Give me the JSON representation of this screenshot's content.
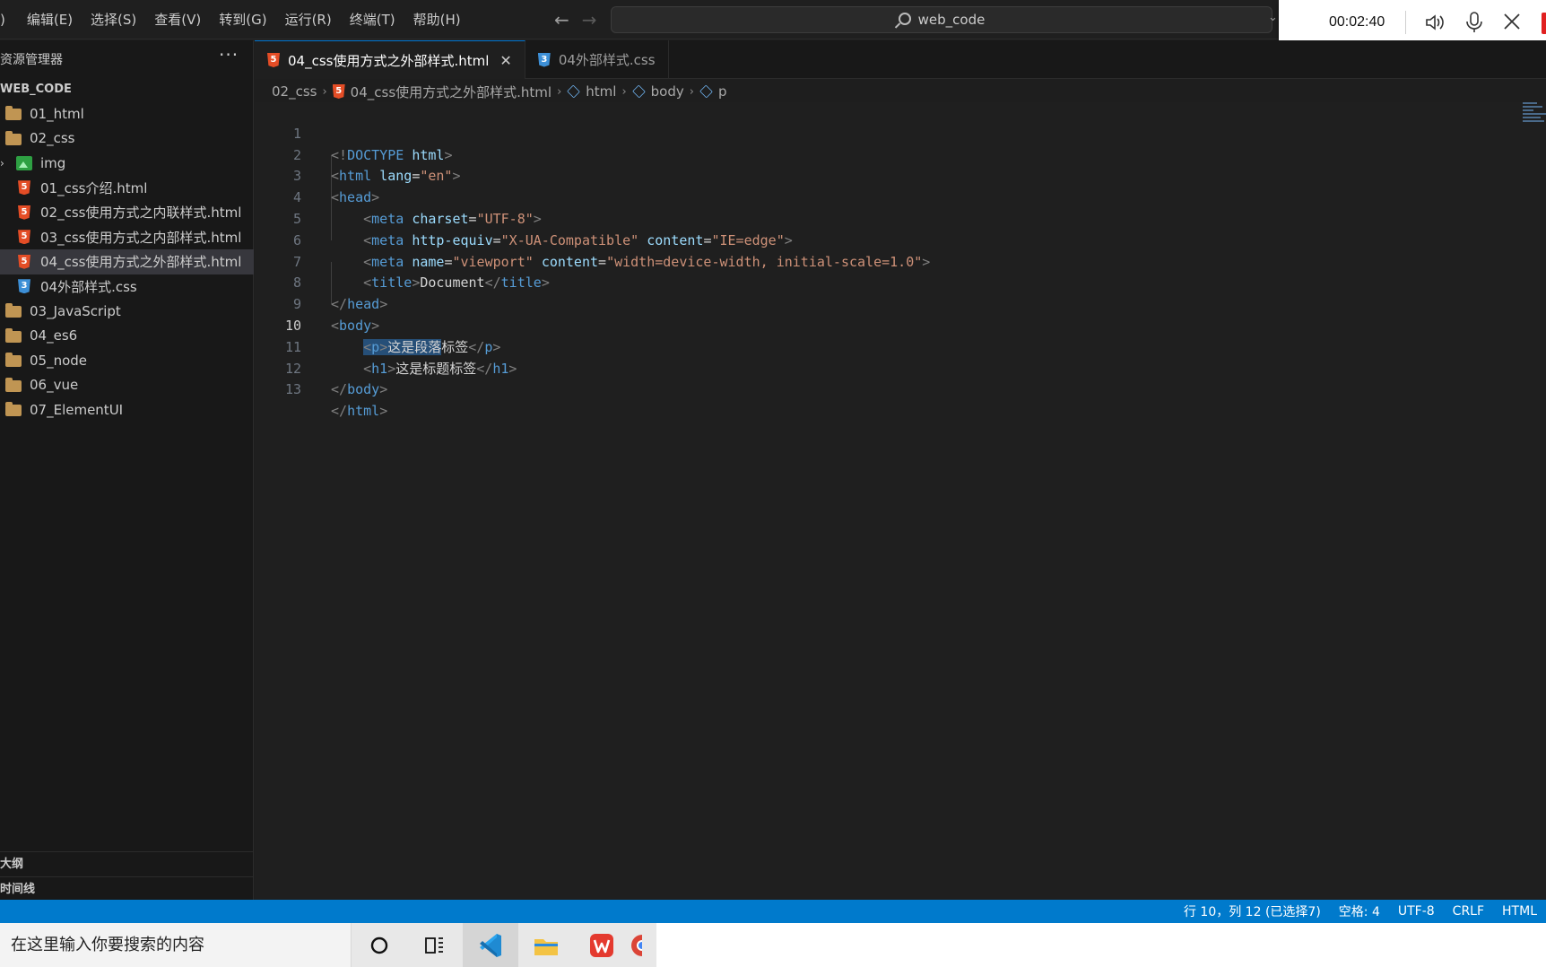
{
  "menu": {
    "items": [
      ")",
      "编辑(E)",
      "选择(S)",
      "查看(V)",
      "转到(G)",
      "运行(R)",
      "终端(T)",
      "帮助(H)"
    ]
  },
  "command_center": {
    "text": "web_code"
  },
  "recorder": {
    "time": "00:02:40"
  },
  "sidebar": {
    "title": "资源管理器",
    "more": "···",
    "workspace": "WEB_CODE",
    "tree": [
      {
        "label": "01_html",
        "kind": "folder"
      },
      {
        "label": "02_css",
        "kind": "folder"
      },
      {
        "label": "img",
        "kind": "img-folder"
      },
      {
        "label": "01_css介绍.html",
        "kind": "html"
      },
      {
        "label": "02_css使用方式之内联样式.html",
        "kind": "html"
      },
      {
        "label": "03_css使用方式之内部样式.html",
        "kind": "html"
      },
      {
        "label": "04_css使用方式之外部样式.html",
        "kind": "html",
        "selected": true
      },
      {
        "label": "04外部样式.css",
        "kind": "css"
      },
      {
        "label": "03_JavaScript",
        "kind": "folder"
      },
      {
        "label": "04_es6",
        "kind": "folder"
      },
      {
        "label": "05_node",
        "kind": "folder"
      },
      {
        "label": "06_vue",
        "kind": "folder"
      },
      {
        "label": "07_ElementUI",
        "kind": "folder"
      }
    ],
    "outline": "大纲",
    "timeline": "时间线"
  },
  "tabs": [
    {
      "label": "04_css使用方式之外部样式.html",
      "active": true
    },
    {
      "label": "04外部样式.css",
      "active": false
    }
  ],
  "breadcrumb": {
    "folder": "02_css",
    "file": "04_css使用方式之外部样式.html",
    "html": "html",
    "body": "body",
    "p": "p"
  },
  "editor": {
    "current_line": 10,
    "line_numbers": [
      "1",
      "2",
      "3",
      "4",
      "5",
      "6",
      "7",
      "8",
      "9",
      "10",
      "11",
      "12",
      "13"
    ]
  },
  "status": {
    "position": "行 10，列 12 (已选择7)",
    "spaces": "空格: 4",
    "encoding": "UTF-8",
    "eol": "CRLF",
    "language": "HTML"
  },
  "taskbar": {
    "search_placeholder": "在这里输入你要搜索的内容"
  },
  "colors": {
    "accent": "#007acc",
    "html_icon": "#e44d26",
    "css_icon": "#3d8fd6",
    "folder": "#c09553"
  }
}
